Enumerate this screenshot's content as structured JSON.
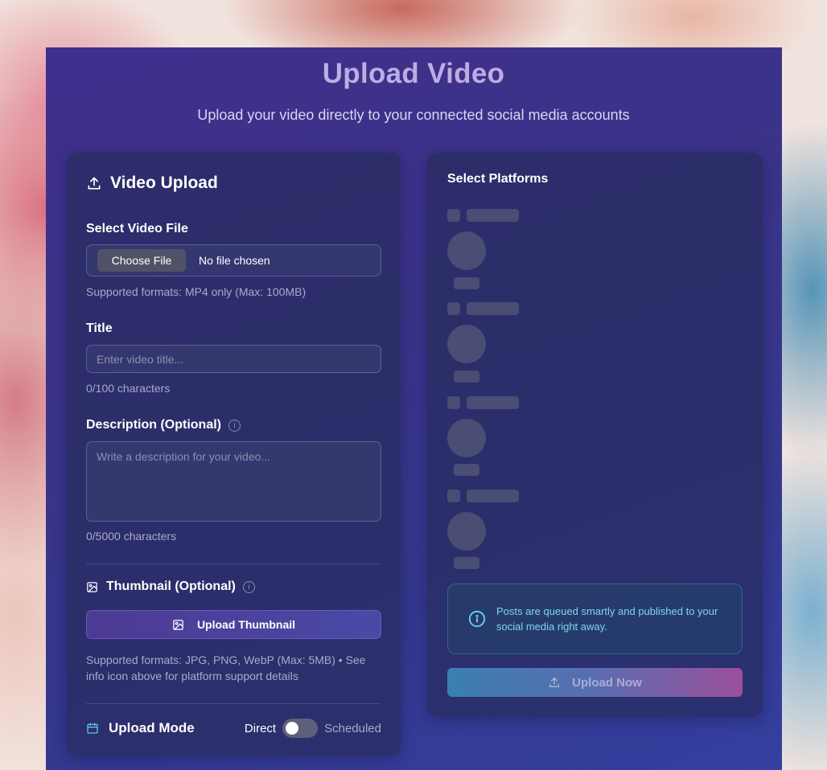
{
  "header": {
    "title": "Upload Video",
    "subtitle": "Upload your video directly to your connected social media accounts"
  },
  "video_upload": {
    "heading": "Video Upload",
    "file": {
      "label": "Select Video File",
      "choose_button": "Choose File",
      "status": "No file chosen",
      "hint": "Supported formats: MP4 only (Max: 100MB)"
    },
    "title": {
      "label": "Title",
      "placeholder": "Enter video title...",
      "counter": "0/100 characters"
    },
    "description": {
      "label": "Description (Optional)",
      "placeholder": "Write a description for your video...",
      "counter": "0/5000 characters"
    },
    "thumbnail": {
      "label": "Thumbnail (Optional)",
      "button": "Upload Thumbnail",
      "hint": "Supported formats: JPG, PNG, WebP (Max: 5MB) • See info icon above for platform support details"
    },
    "mode": {
      "label": "Upload Mode",
      "left_option": "Direct",
      "right_option": "Scheduled",
      "scheduled_on": false
    }
  },
  "platforms": {
    "heading": "Select Platforms",
    "notice": "Posts are queued smartly and published to your social media right away.",
    "upload_button": "Upload Now"
  },
  "icons": {
    "video_upload": "upload-icon",
    "thumbnail": "image-icon",
    "mode": "calendar-icon",
    "notice": "info-circle-icon",
    "upload_now": "upload-icon"
  }
}
